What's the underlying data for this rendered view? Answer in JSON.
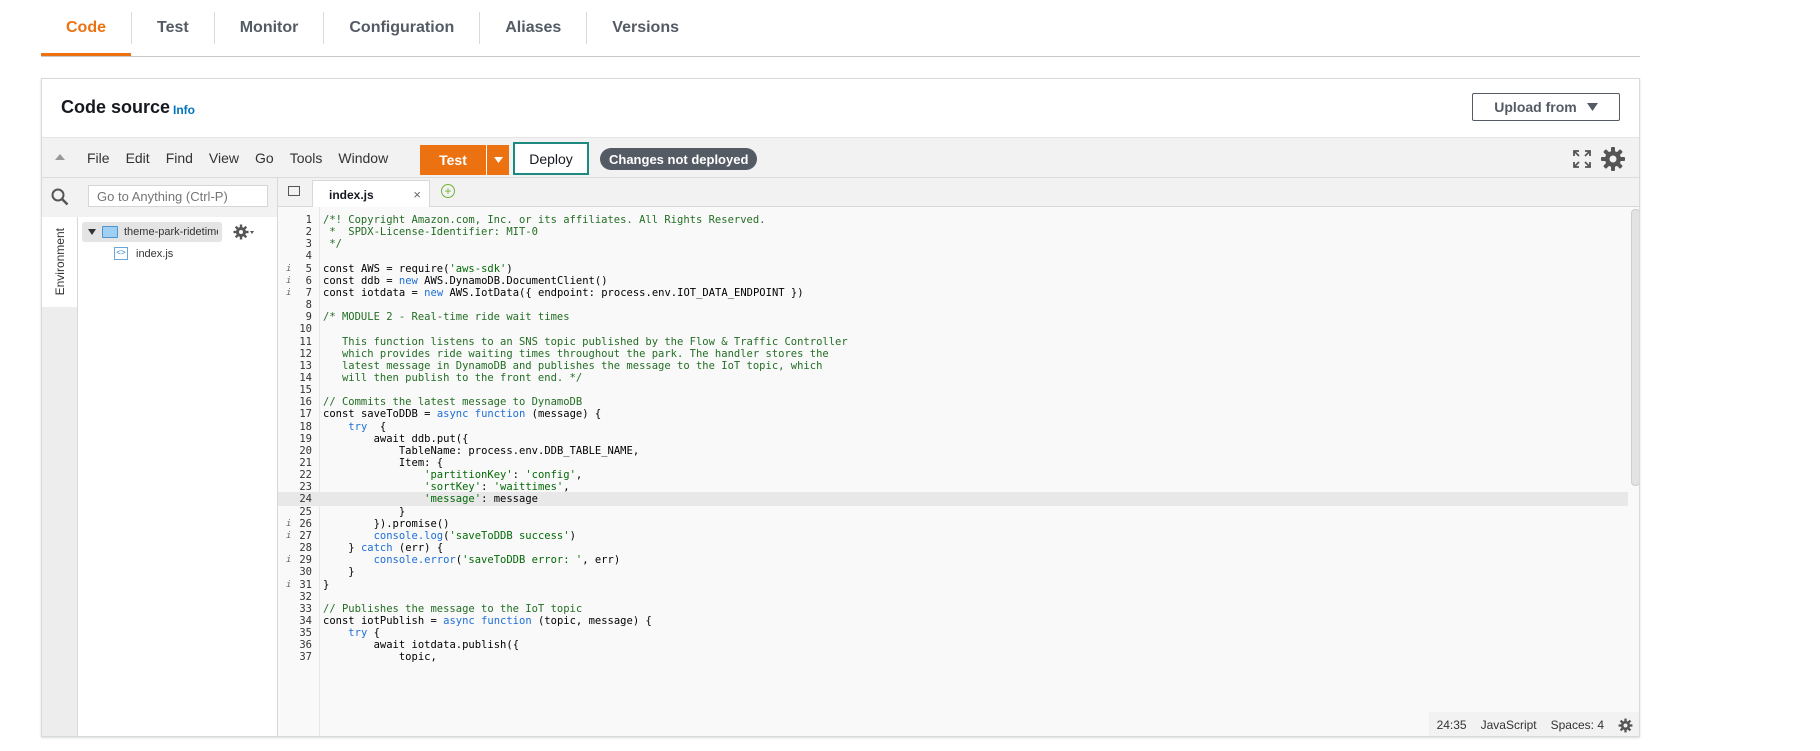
{
  "tabs": [
    {
      "label": "Code",
      "active": true
    },
    {
      "label": "Test"
    },
    {
      "label": "Monitor"
    },
    {
      "label": "Configuration"
    },
    {
      "label": "Aliases"
    },
    {
      "label": "Versions"
    }
  ],
  "panel": {
    "title": "Code source",
    "info": "Info",
    "upload_label": "Upload from"
  },
  "toolbar": {
    "menu": [
      "File",
      "Edit",
      "Find",
      "View",
      "Go",
      "Tools",
      "Window"
    ],
    "test_label": "Test",
    "deploy_label": "Deploy",
    "status_badge": "Changes not deployed"
  },
  "sidebar": {
    "environment_label": "Environment",
    "search_placeholder": "Go to Anything (Ctrl-P)",
    "folder": "theme-park-ridetimes",
    "file": "index.js"
  },
  "editor": {
    "tab_label": "index.js",
    "close_glyph": "×",
    "add_glyph": "+",
    "active_line": 24,
    "lines": [
      {
        "n": 1,
        "t": "/*! Copyright Amazon.com, Inc. or its affiliates. All Rights Reserved."
      },
      {
        "n": 2,
        "t": " *  SPDX-License-Identifier: MIT-0"
      },
      {
        "n": 3,
        "t": " */"
      },
      {
        "n": 4,
        "t": ""
      },
      {
        "n": 5,
        "t": "const AWS = require('aws-sdk')",
        "a": true
      },
      {
        "n": 6,
        "t": "const ddb = new AWS.DynamoDB.DocumentClient()",
        "a": true
      },
      {
        "n": 7,
        "t": "const iotdata = new AWS.IotData({ endpoint: process.env.IOT_DATA_ENDPOINT })",
        "a": true
      },
      {
        "n": 8,
        "t": ""
      },
      {
        "n": 9,
        "t": "/* MODULE 2 - Real-time ride wait times"
      },
      {
        "n": 10,
        "t": ""
      },
      {
        "n": 11,
        "t": "   This function listens to an SNS topic published by the Flow & Traffic Controller"
      },
      {
        "n": 12,
        "t": "   which provides ride waiting times throughout the park. The handler stores the"
      },
      {
        "n": 13,
        "t": "   latest message in DynamoDB and publishes the message to the IoT topic, which"
      },
      {
        "n": 14,
        "t": "   will then publish to the front end. */"
      },
      {
        "n": 15,
        "t": ""
      },
      {
        "n": 16,
        "t": "// Commits the latest message to DynamoDB"
      },
      {
        "n": 17,
        "t": "const saveToDDB = async function (message) {"
      },
      {
        "n": 18,
        "t": "    try  {"
      },
      {
        "n": 19,
        "t": "        await ddb.put({"
      },
      {
        "n": 20,
        "t": "            TableName: process.env.DDB_TABLE_NAME,"
      },
      {
        "n": 21,
        "t": "            Item: {"
      },
      {
        "n": 22,
        "t": "                'partitionKey': 'config',"
      },
      {
        "n": 23,
        "t": "                'sortKey': 'waittimes',"
      },
      {
        "n": 24,
        "t": "                'message': message"
      },
      {
        "n": 25,
        "t": "            }"
      },
      {
        "n": 26,
        "t": "        }).promise()",
        "a": true
      },
      {
        "n": 27,
        "t": "        console.log('saveToDDB success')",
        "a": true
      },
      {
        "n": 28,
        "t": "    } catch (err) {"
      },
      {
        "n": 29,
        "t": "        console.error('saveToDDB error: ', err)",
        "a": true
      },
      {
        "n": 30,
        "t": "    }"
      },
      {
        "n": 31,
        "t": "}",
        "a": true
      },
      {
        "n": 32,
        "t": ""
      },
      {
        "n": 33,
        "t": "// Publishes the message to the IoT topic"
      },
      {
        "n": 34,
        "t": "const iotPublish = async function (topic, message) {"
      },
      {
        "n": 35,
        "t": "    try {"
      },
      {
        "n": 36,
        "t": "        await iotdata.publish({"
      },
      {
        "n": 37,
        "t": "            topic,"
      }
    ]
  },
  "status": {
    "cursor": "24:35",
    "language": "JavaScript",
    "spaces": "Spaces: 4"
  },
  "colors": {
    "accent": "#ec7211",
    "deploy_border": "#1d8a80",
    "info_link": "#0073bb",
    "badge": "#545b64"
  }
}
